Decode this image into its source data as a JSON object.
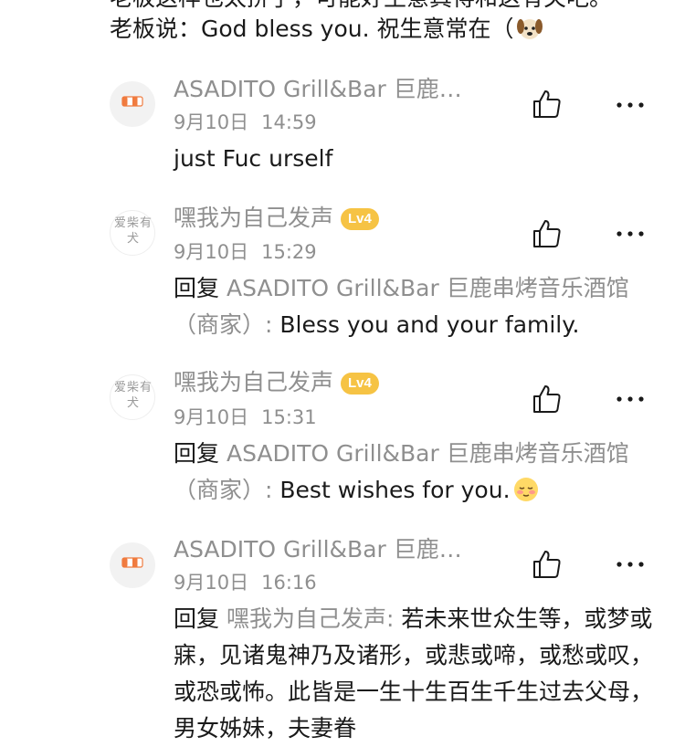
{
  "top_text": {
    "clipped_line": "老板这样也太拼了，可能好生意真得和这有关吧。",
    "line": "老板说：God bless you. 祝生意常在（"
  },
  "comments": [
    {
      "name": "ASADITO Grill&Bar 巨鹿…",
      "date": "9月10日",
      "time": "14:59",
      "text": "just Fuc urself"
    },
    {
      "name": "嘿我为自己发声",
      "level": "Lv4",
      "avatar_text": "爱柴有犬",
      "date": "9月10日",
      "time": "15:29",
      "reply_label": "回复",
      "reply_to": "ASADITO Grill&Bar 巨鹿串烤音乐酒馆（商家）:",
      "text": "Bless you and your family."
    },
    {
      "name": "嘿我为自己发声",
      "level": "Lv4",
      "avatar_text": "爱柴有犬",
      "date": "9月10日",
      "time": "15:31",
      "reply_label": "回复",
      "reply_to": "ASADITO Grill&Bar 巨鹿串烤音乐酒馆（商家）:",
      "text": "Best wishes for you."
    },
    {
      "name": "ASADITO Grill&Bar 巨鹿…",
      "date": "9月10日",
      "time": "16:16",
      "reply_label": "回复",
      "reply_to": "嘿我为自己发声:",
      "text": "若未来世众生等，或梦或寐，见诸鬼神乃及诸形，或悲或啼，或愁或叹，或恐或怖。此皆是一生十生百生千生过去父母，男女姊妹，夫妻眷"
    }
  ],
  "icons": {
    "like": "thumbs-up-icon",
    "more": "more-dots-icon",
    "merchant_avatar": "store-awning-icon",
    "dog_emoji": "dog-face-emoji",
    "blush_emoji": "blushing-face-emoji"
  },
  "colors": {
    "text": "#1a1a1a",
    "secondary": "#8f8f8f",
    "level_badge": "#f6c344",
    "awning": "#f07b3f"
  }
}
